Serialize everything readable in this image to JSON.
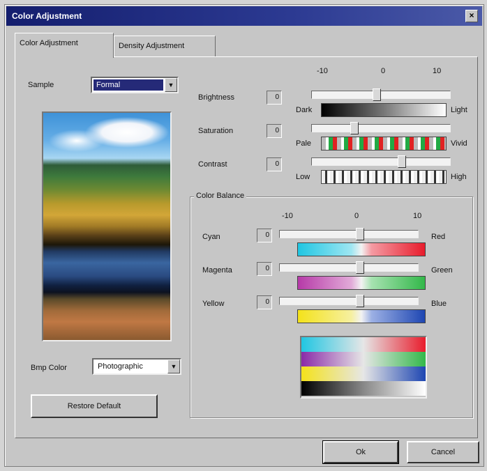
{
  "window": {
    "title": "Color Adjustment",
    "close_label": "×"
  },
  "tabs": [
    {
      "label": "Color Adjustment",
      "active": true
    },
    {
      "label": "Density Adjustment",
      "active": false
    }
  ],
  "sample": {
    "label": "Sample",
    "value": "Formal"
  },
  "bitmap_color": {
    "label": "Bmp Color",
    "value": "Photographic"
  },
  "restore_default": "Restore Default",
  "scale": {
    "min": "-10",
    "mid": "0",
    "max": "10"
  },
  "adjustments": [
    {
      "label": "Brightness",
      "value": "0",
      "low": "Dark",
      "high": "Light"
    },
    {
      "label": "Saturation",
      "value": "0",
      "low": "Pale",
      "high": "Vivid"
    },
    {
      "label": "Contrast",
      "value": "0",
      "low": "Low",
      "high": "High"
    }
  ],
  "color_balance": {
    "title": "Color Balance",
    "scale": {
      "min": "-10",
      "mid": "0",
      "max": "10"
    },
    "rows": [
      {
        "label": "Cyan",
        "value": "0",
        "right": "Red"
      },
      {
        "label": "Magenta",
        "value": "0",
        "right": "Green"
      },
      {
        "label": "Yellow",
        "value": "0",
        "right": "Blue"
      }
    ]
  },
  "buttons": {
    "ok": "Ok",
    "cancel": "Cancel"
  },
  "icons": {
    "dropdown_arrow": "▼"
  },
  "colors": {
    "cyan": "#20c6e2",
    "red": "#e81c2c",
    "magenta": "#b63aa8",
    "green": "#33b84a",
    "yellow": "#f4e21a",
    "blue": "#1e46b2",
    "title_dark": "#141e6e"
  }
}
